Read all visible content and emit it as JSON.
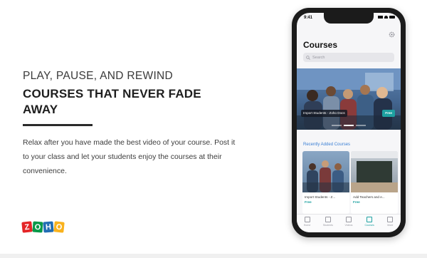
{
  "headline": {
    "line1": "PLAY, PAUSE, AND REWIND",
    "line2": "COURSES THAT NEVER FADE AWAY"
  },
  "body": "Relax after you have made the best video of your course. Post it to your class and let your students enjoy the courses at their convenience.",
  "logo": {
    "letters": [
      "Z",
      "O",
      "H",
      "O"
    ],
    "colors": [
      "#e42527",
      "#089949",
      "#226db4",
      "#f9b21d"
    ]
  },
  "phone": {
    "status_time": "9:41",
    "app_title": "Courses",
    "search_placeholder": "Search",
    "featured": {
      "caption": "Import Students - Zoho Docs",
      "tag": "Free"
    },
    "section_title": "Recently Added Courses",
    "courses": [
      {
        "title": "Import Students - Z...",
        "tag": "Free"
      },
      {
        "title": "Add Teachers and e...",
        "tag": "Free"
      }
    ],
    "tabs": [
      {
        "label": "Home",
        "icon": "home-icon"
      },
      {
        "label": "Students",
        "icon": "students-icon"
      },
      {
        "label": "Videos",
        "icon": "videos-icon"
      },
      {
        "label": "Courses",
        "icon": "courses-icon",
        "active": true
      },
      {
        "label": "More",
        "icon": "more-icon"
      }
    ]
  }
}
